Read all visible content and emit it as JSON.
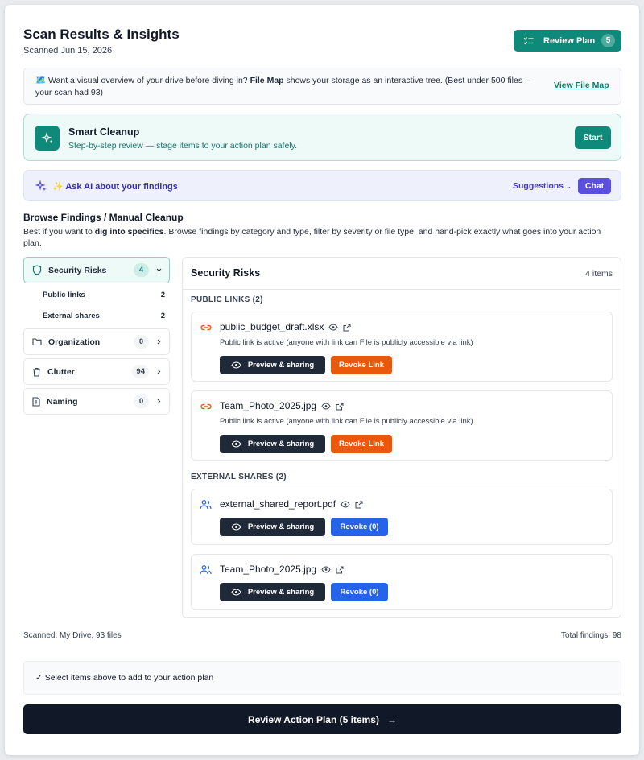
{
  "header": {
    "title": "Scan Results & Insights",
    "subtitle": "Scanned Jun 15, 2026",
    "review_plan_label": "Review Plan",
    "review_plan_count": "5"
  },
  "file_map_banner": {
    "icon": "🗺️",
    "text_prefix": " Want a visual overview of your drive before diving in? ",
    "text_bold": "File Map",
    "text_suffix": " shows your storage as an interactive tree. (Best under 500 files — your scan had 93)",
    "link": "View File Map"
  },
  "smart_cleanup": {
    "title": "Smart Cleanup",
    "subtitle": "Step-by-step review — stage items to your action plan safely.",
    "button": "Start"
  },
  "ask_ai": {
    "label": "✨ Ask AI about your findings",
    "suggestions": "Suggestions",
    "chat": "Chat"
  },
  "browse": {
    "title": "Browse Findings / Manual Cleanup",
    "desc_prefix": "Best if you want to ",
    "desc_bold": "dig into specifics",
    "desc_suffix": ". Browse findings by category and type, filter by severity or file type, and hand-pick exactly what goes into your action plan."
  },
  "sidebar": {
    "items": [
      {
        "label": "Security Risks",
        "count": "4",
        "icon": "shield-icon"
      },
      {
        "label": "Organization",
        "count": "0",
        "icon": "folder-icon"
      },
      {
        "label": "Clutter",
        "count": "94",
        "icon": "trash-icon"
      },
      {
        "label": "Naming",
        "count": "0",
        "icon": "file-alert-icon"
      }
    ],
    "sub_items": [
      {
        "label": "Public links",
        "count": "2"
      },
      {
        "label": "External shares",
        "count": "2"
      }
    ]
  },
  "panel": {
    "title": "Security Risks",
    "count": "4 items",
    "sections": [
      {
        "label": "PUBLIC LINKS (2)",
        "items": [
          {
            "name": "public_budget_draft.xlsx",
            "desc": "Public link is active (anyone with link can File is publicly accessible via link)",
            "preview": "Preview & sharing",
            "action": "Revoke Link"
          },
          {
            "name": "Team_Photo_2025.jpg",
            "desc": "Public link is active (anyone with link can File is publicly accessible via link)",
            "preview": "Preview & sharing",
            "action": "Revoke Link"
          }
        ]
      },
      {
        "label": "EXTERNAL SHARES (2)",
        "items": [
          {
            "name": "external_shared_report.pdf",
            "preview": "Preview & sharing",
            "action": "Revoke (0)"
          },
          {
            "name": "Team_Photo_2025.jpg",
            "preview": "Preview & sharing",
            "action": "Revoke (0)"
          }
        ]
      }
    ]
  },
  "footer": {
    "scanned": "Scanned: My Drive, 93 files",
    "total": "Total findings: 98",
    "select_hint": "✓ Select items above to add to your action plan",
    "review_action": "Review Action Plan (5 items)",
    "review_arrow": "→"
  },
  "colors": {
    "teal": "#0f8a7a",
    "orange": "#ea580c",
    "blue": "#2563eb",
    "dark": "#111827",
    "indigo": "#5b4fe0"
  }
}
